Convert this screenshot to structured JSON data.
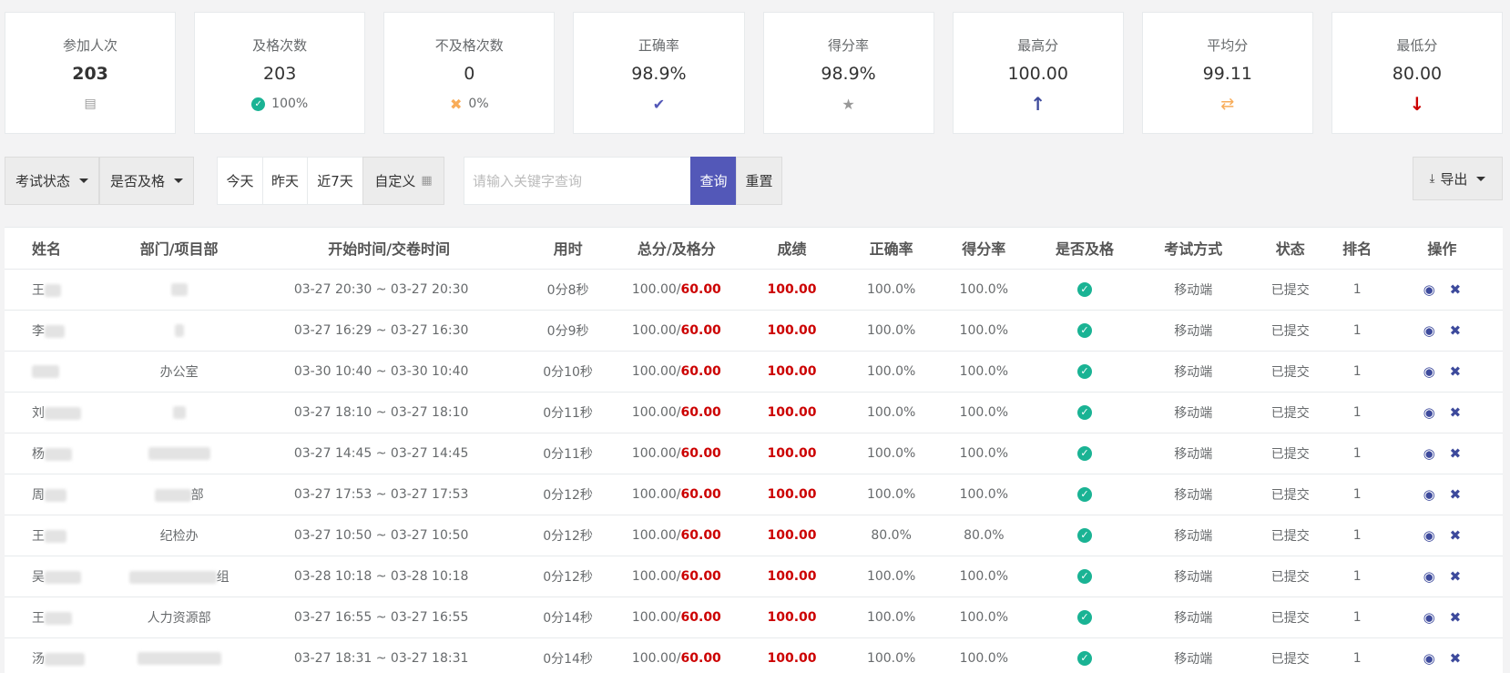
{
  "stats": [
    {
      "label": "参加人次",
      "value": "203",
      "icon": "id-card-icon",
      "glyph": "▤",
      "color": "#999999",
      "bold": true,
      "extra": ""
    },
    {
      "label": "及格次数",
      "value": "203",
      "icon": "check-circle-icon",
      "glyph": "✓",
      "color": "#1ab394",
      "bold": false,
      "extra": "100%"
    },
    {
      "label": "不及格次数",
      "value": "0",
      "icon": "times-icon",
      "glyph": "✖",
      "color": "#f8ac59",
      "bold": false,
      "extra": "0%"
    },
    {
      "label": "正确率",
      "value": "98.9%",
      "icon": "check-icon",
      "glyph": "✔",
      "color": "#5358b8",
      "bold": false,
      "extra": ""
    },
    {
      "label": "得分率",
      "value": "98.9%",
      "icon": "star-icon",
      "glyph": "★",
      "color": "#999999",
      "bold": false,
      "extra": ""
    },
    {
      "label": "最高分",
      "value": "100.00",
      "icon": "arrow-up-icon",
      "glyph": "↑",
      "color": "#3d4a9c",
      "bold": false,
      "extra": ""
    },
    {
      "label": "平均分",
      "value": "99.11",
      "icon": "exchange-icon",
      "glyph": "⇄",
      "color": "#f8ac59",
      "bold": false,
      "extra": ""
    },
    {
      "label": "最低分",
      "value": "80.00",
      "icon": "arrow-down-icon",
      "glyph": "↓",
      "color": "#cc0000",
      "bold": false,
      "extra": ""
    }
  ],
  "toolbar": {
    "exam_status": "考试状态",
    "pass_filter": "是否及格",
    "today": "今天",
    "yesterday": "昨天",
    "last7": "近7天",
    "custom": "自定义",
    "search_placeholder": "请输入关键字查询",
    "query": "查询",
    "reset": "重置",
    "export": "导出"
  },
  "table": {
    "headers": [
      "姓名",
      "部门/项目部",
      "开始时间/交卷时间",
      "用时",
      "总分/及格分",
      "成绩",
      "正确率",
      "得分率",
      "是否及格",
      "考试方式",
      "状态",
      "排名",
      "操作"
    ],
    "rows": [
      {
        "name": "王",
        "dept": "",
        "time": "03-27 20:30 ~ 03-27 20:30",
        "dur": "0分8秒",
        "total": "100.00/",
        "pass": "60.00",
        "score": "100.00",
        "acc": "100.0%",
        "rate": "100.0%",
        "mode": "移动端",
        "status": "已提交",
        "rank": "1"
      },
      {
        "name": "李",
        "dept": "",
        "time": "03-27 16:29 ~ 03-27 16:30",
        "dur": "0分9秒",
        "total": "100.00/",
        "pass": "60.00",
        "score": "100.00",
        "acc": "100.0%",
        "rate": "100.0%",
        "mode": "移动端",
        "status": "已提交",
        "rank": "1"
      },
      {
        "name": "",
        "dept": "办公室",
        "time": "03-30 10:40 ~ 03-30 10:40",
        "dur": "0分10秒",
        "total": "100.00/",
        "pass": "60.00",
        "score": "100.00",
        "acc": "100.0%",
        "rate": "100.0%",
        "mode": "移动端",
        "status": "已提交",
        "rank": "1"
      },
      {
        "name": "刘",
        "dept": "",
        "time": "03-27 18:10 ~ 03-27 18:10",
        "dur": "0分11秒",
        "total": "100.00/",
        "pass": "60.00",
        "score": "100.00",
        "acc": "100.0%",
        "rate": "100.0%",
        "mode": "移动端",
        "status": "已提交",
        "rank": "1"
      },
      {
        "name": "杨",
        "dept": "",
        "time": "03-27 14:45 ~ 03-27 14:45",
        "dur": "0分11秒",
        "total": "100.00/",
        "pass": "60.00",
        "score": "100.00",
        "acc": "100.0%",
        "rate": "100.0%",
        "mode": "移动端",
        "status": "已提交",
        "rank": "1"
      },
      {
        "name": "周",
        "dept": "部",
        "time": "03-27 17:53 ~ 03-27 17:53",
        "dur": "0分12秒",
        "total": "100.00/",
        "pass": "60.00",
        "score": "100.00",
        "acc": "100.0%",
        "rate": "100.0%",
        "mode": "移动端",
        "status": "已提交",
        "rank": "1"
      },
      {
        "name": "王",
        "dept": "纪检办",
        "time": "03-27 10:50 ~ 03-27 10:50",
        "dur": "0分12秒",
        "total": "100.00/",
        "pass": "60.00",
        "score": "100.00",
        "acc": "80.0%",
        "rate": "80.0%",
        "mode": "移动端",
        "status": "已提交",
        "rank": "1"
      },
      {
        "name": "吴",
        "dept": "组",
        "time": "03-28 10:18 ~ 03-28 10:18",
        "dur": "0分12秒",
        "total": "100.00/",
        "pass": "60.00",
        "score": "100.00",
        "acc": "100.0%",
        "rate": "100.0%",
        "mode": "移动端",
        "status": "已提交",
        "rank": "1"
      },
      {
        "name": "王",
        "dept": "人力资源部",
        "time": "03-27 16:55 ~ 03-27 16:55",
        "dur": "0分14秒",
        "total": "100.00/",
        "pass": "60.00",
        "score": "100.00",
        "acc": "100.0%",
        "rate": "100.0%",
        "mode": "移动端",
        "status": "已提交",
        "rank": "1"
      },
      {
        "name": "汤",
        "dept": "",
        "time": "03-27 18:31 ~ 03-27 18:31",
        "dur": "0分14秒",
        "total": "100.00/",
        "pass": "60.00",
        "score": "100.00",
        "acc": "100.0%",
        "rate": "100.0%",
        "mode": "移动端",
        "status": "已提交",
        "rank": "1"
      }
    ]
  }
}
